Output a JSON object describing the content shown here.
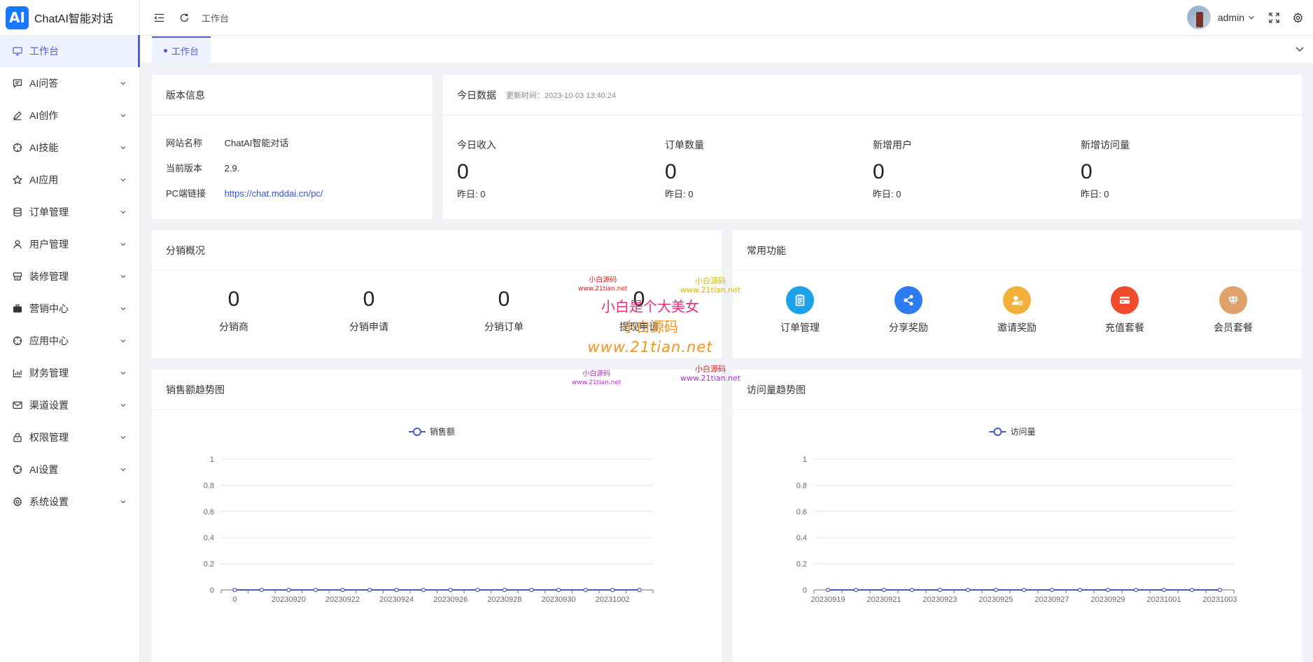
{
  "app": {
    "logo_text": "AI",
    "title": "ChatAI智能对话"
  },
  "sidebar": {
    "items": [
      {
        "label": "工作台",
        "icon": "monitor-icon"
      },
      {
        "label": "AI问答",
        "icon": "chat-icon"
      },
      {
        "label": "AI创作",
        "icon": "pen-icon"
      },
      {
        "label": "AI技能",
        "icon": "target-icon"
      },
      {
        "label": "AI应用",
        "icon": "star-icon"
      },
      {
        "label": "订单管理",
        "icon": "database-icon"
      },
      {
        "label": "用户管理",
        "icon": "user-icon"
      },
      {
        "label": "装修管理",
        "icon": "paint-icon"
      },
      {
        "label": "营销中心",
        "icon": "briefcase-icon"
      },
      {
        "label": "应用中心",
        "icon": "target-icon"
      },
      {
        "label": "财务管理",
        "icon": "bar-chart-icon"
      },
      {
        "label": "渠道设置",
        "icon": "mail-icon"
      },
      {
        "label": "权限管理",
        "icon": "lock-icon"
      },
      {
        "label": "AI设置",
        "icon": "target-icon"
      },
      {
        "label": "系统设置",
        "icon": "gear-icon"
      }
    ]
  },
  "header": {
    "breadcrumb": "工作台",
    "user": "admin"
  },
  "tabs": [
    {
      "label": "工作台"
    }
  ],
  "version_card": {
    "title": "版本信息",
    "rows": [
      {
        "label": "网站名称",
        "value": "ChatAI智能对话"
      },
      {
        "label": "当前版本",
        "value": "2.9."
      },
      {
        "label": "PC端链接",
        "value": "https://chat.mddai.cn/pc/"
      }
    ]
  },
  "today_card": {
    "title": "今日数据",
    "updated": "更新时间：2023-10-03 13:40:24",
    "stats": [
      {
        "label": "今日收入",
        "value": "0",
        "yesterday": "昨日: 0"
      },
      {
        "label": "订单数量",
        "value": "0",
        "yesterday": "昨日: 0"
      },
      {
        "label": "新增用户",
        "value": "0",
        "yesterday": "昨日: 0"
      },
      {
        "label": "新增访问量",
        "value": "0",
        "yesterday": "昨日: 0"
      }
    ]
  },
  "dist_card": {
    "title": "分销概况",
    "items": [
      {
        "value": "0",
        "label": "分销商"
      },
      {
        "value": "0",
        "label": "分销申请"
      },
      {
        "value": "0",
        "label": "分销订单"
      },
      {
        "value": "0",
        "label": "提现申请"
      }
    ]
  },
  "func_card": {
    "title": "常用功能",
    "items": [
      {
        "label": "订单管理",
        "icon": "clipboard-icon",
        "color": "#1aa3e8"
      },
      {
        "label": "分享奖励",
        "icon": "share-icon",
        "color": "#2b7cf0"
      },
      {
        "label": "邀请奖励",
        "icon": "user-add-icon",
        "color": "#f2b03a"
      },
      {
        "label": "充值套餐",
        "icon": "card-icon",
        "color": "#ee4b2b"
      },
      {
        "label": "会员套餐",
        "icon": "diamond-icon",
        "color": "#e0a16b"
      }
    ]
  },
  "chart_data": [
    {
      "type": "line",
      "title": "销售额趋势图",
      "series": [
        {
          "name": "销售额",
          "values": [
            0,
            0,
            0,
            0,
            0,
            0,
            0,
            0,
            0,
            0,
            0,
            0,
            0,
            0,
            0,
            0
          ]
        }
      ],
      "x": [
        "0",
        "20230919",
        "20230920",
        "20230921",
        "20230922",
        "20230923",
        "20230924",
        "20230925",
        "20230926",
        "20230927",
        "20230928",
        "20230929",
        "20230930",
        "20231001",
        "20231002",
        "20231003"
      ],
      "x_tick_labels": [
        "0",
        "20230920",
        "20230922",
        "20230924",
        "20230926",
        "20230928",
        "20230930",
        "20231002"
      ],
      "y_ticks": [
        "0",
        "0.2",
        "0.4",
        "0.6",
        "0.8",
        "1"
      ],
      "ylim": [
        0,
        1
      ],
      "color": "#4a5bc4"
    },
    {
      "type": "line",
      "title": "访问量趋势图",
      "series": [
        {
          "name": "访问量",
          "values": [
            0,
            0,
            0,
            0,
            0,
            0,
            0,
            0,
            0,
            0,
            0,
            0,
            0,
            0,
            0
          ]
        }
      ],
      "x": [
        "20230919",
        "20230920",
        "20230921",
        "20230922",
        "20230923",
        "20230924",
        "20230925",
        "20230926",
        "20230927",
        "20230928",
        "20230929",
        "20230930",
        "20231001",
        "20231002",
        "20231003"
      ],
      "x_tick_labels": [
        "20230919",
        "20230921",
        "20230923",
        "20230925",
        "20230927",
        "20230929",
        "20231001",
        "20231003"
      ],
      "y_ticks": [
        "0",
        "0.2",
        "0.4",
        "0.6",
        "0.8",
        "1"
      ],
      "ylim": [
        0,
        1
      ],
      "color": "#4a5bc4"
    }
  ],
  "watermark": {
    "small_1": "小白源码",
    "small_2": "www.21tian.net",
    "big_1": "小白是个大美女",
    "big_2": "小白源码",
    "big_3": "www.21tian.net"
  }
}
